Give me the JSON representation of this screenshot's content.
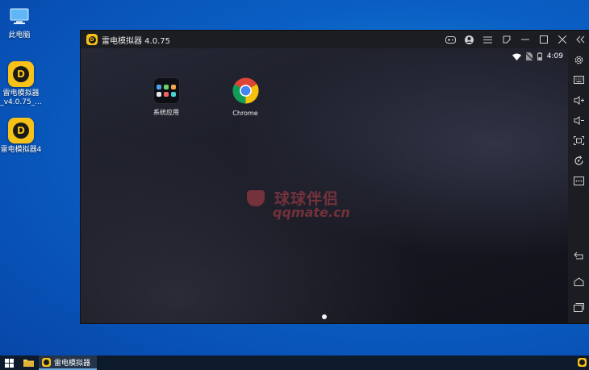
{
  "desktop": {
    "icons": [
      {
        "label": "此电脑",
        "icon": "computer-icon"
      },
      {
        "label": "雷电模拟器",
        "label2": "_v4.0.75_...",
        "icon": "ldplayer-icon"
      },
      {
        "label": "雷电模拟器4",
        "icon": "ldplayer-icon"
      }
    ]
  },
  "window": {
    "title": "雷电模拟器 4.0.75",
    "controls": [
      "gamepad-icon",
      "user-icon",
      "menu-icon",
      "resize-icon",
      "minimize-icon",
      "maximize-icon",
      "close-icon",
      "collapse-icon"
    ]
  },
  "android": {
    "status": {
      "time": "4:09",
      "icons": [
        "wifi-icon",
        "no-sim-icon",
        "battery-icon"
      ]
    },
    "apps": [
      {
        "label": "系统应用",
        "icon": "folder-grid-icon"
      },
      {
        "label": "Chrome",
        "icon": "chrome-icon"
      }
    ],
    "watermark": {
      "cn": "球球伴侣",
      "en": "qqmate.cn"
    }
  },
  "sidebar": {
    "items": [
      "settings-icon",
      "keyboard-icon",
      "volume-up-icon",
      "volume-down-icon",
      "screenshot-icon",
      "rotate-icon",
      "more-icon",
      "back-icon",
      "home-icon",
      "recents-icon"
    ]
  },
  "taskbar": {
    "app_label": "雷电模拟器"
  },
  "colors": {
    "ld_yellow": "#f6c21a",
    "desktop_blue": "#0a5fc4",
    "window_dark": "#1c1d22"
  }
}
